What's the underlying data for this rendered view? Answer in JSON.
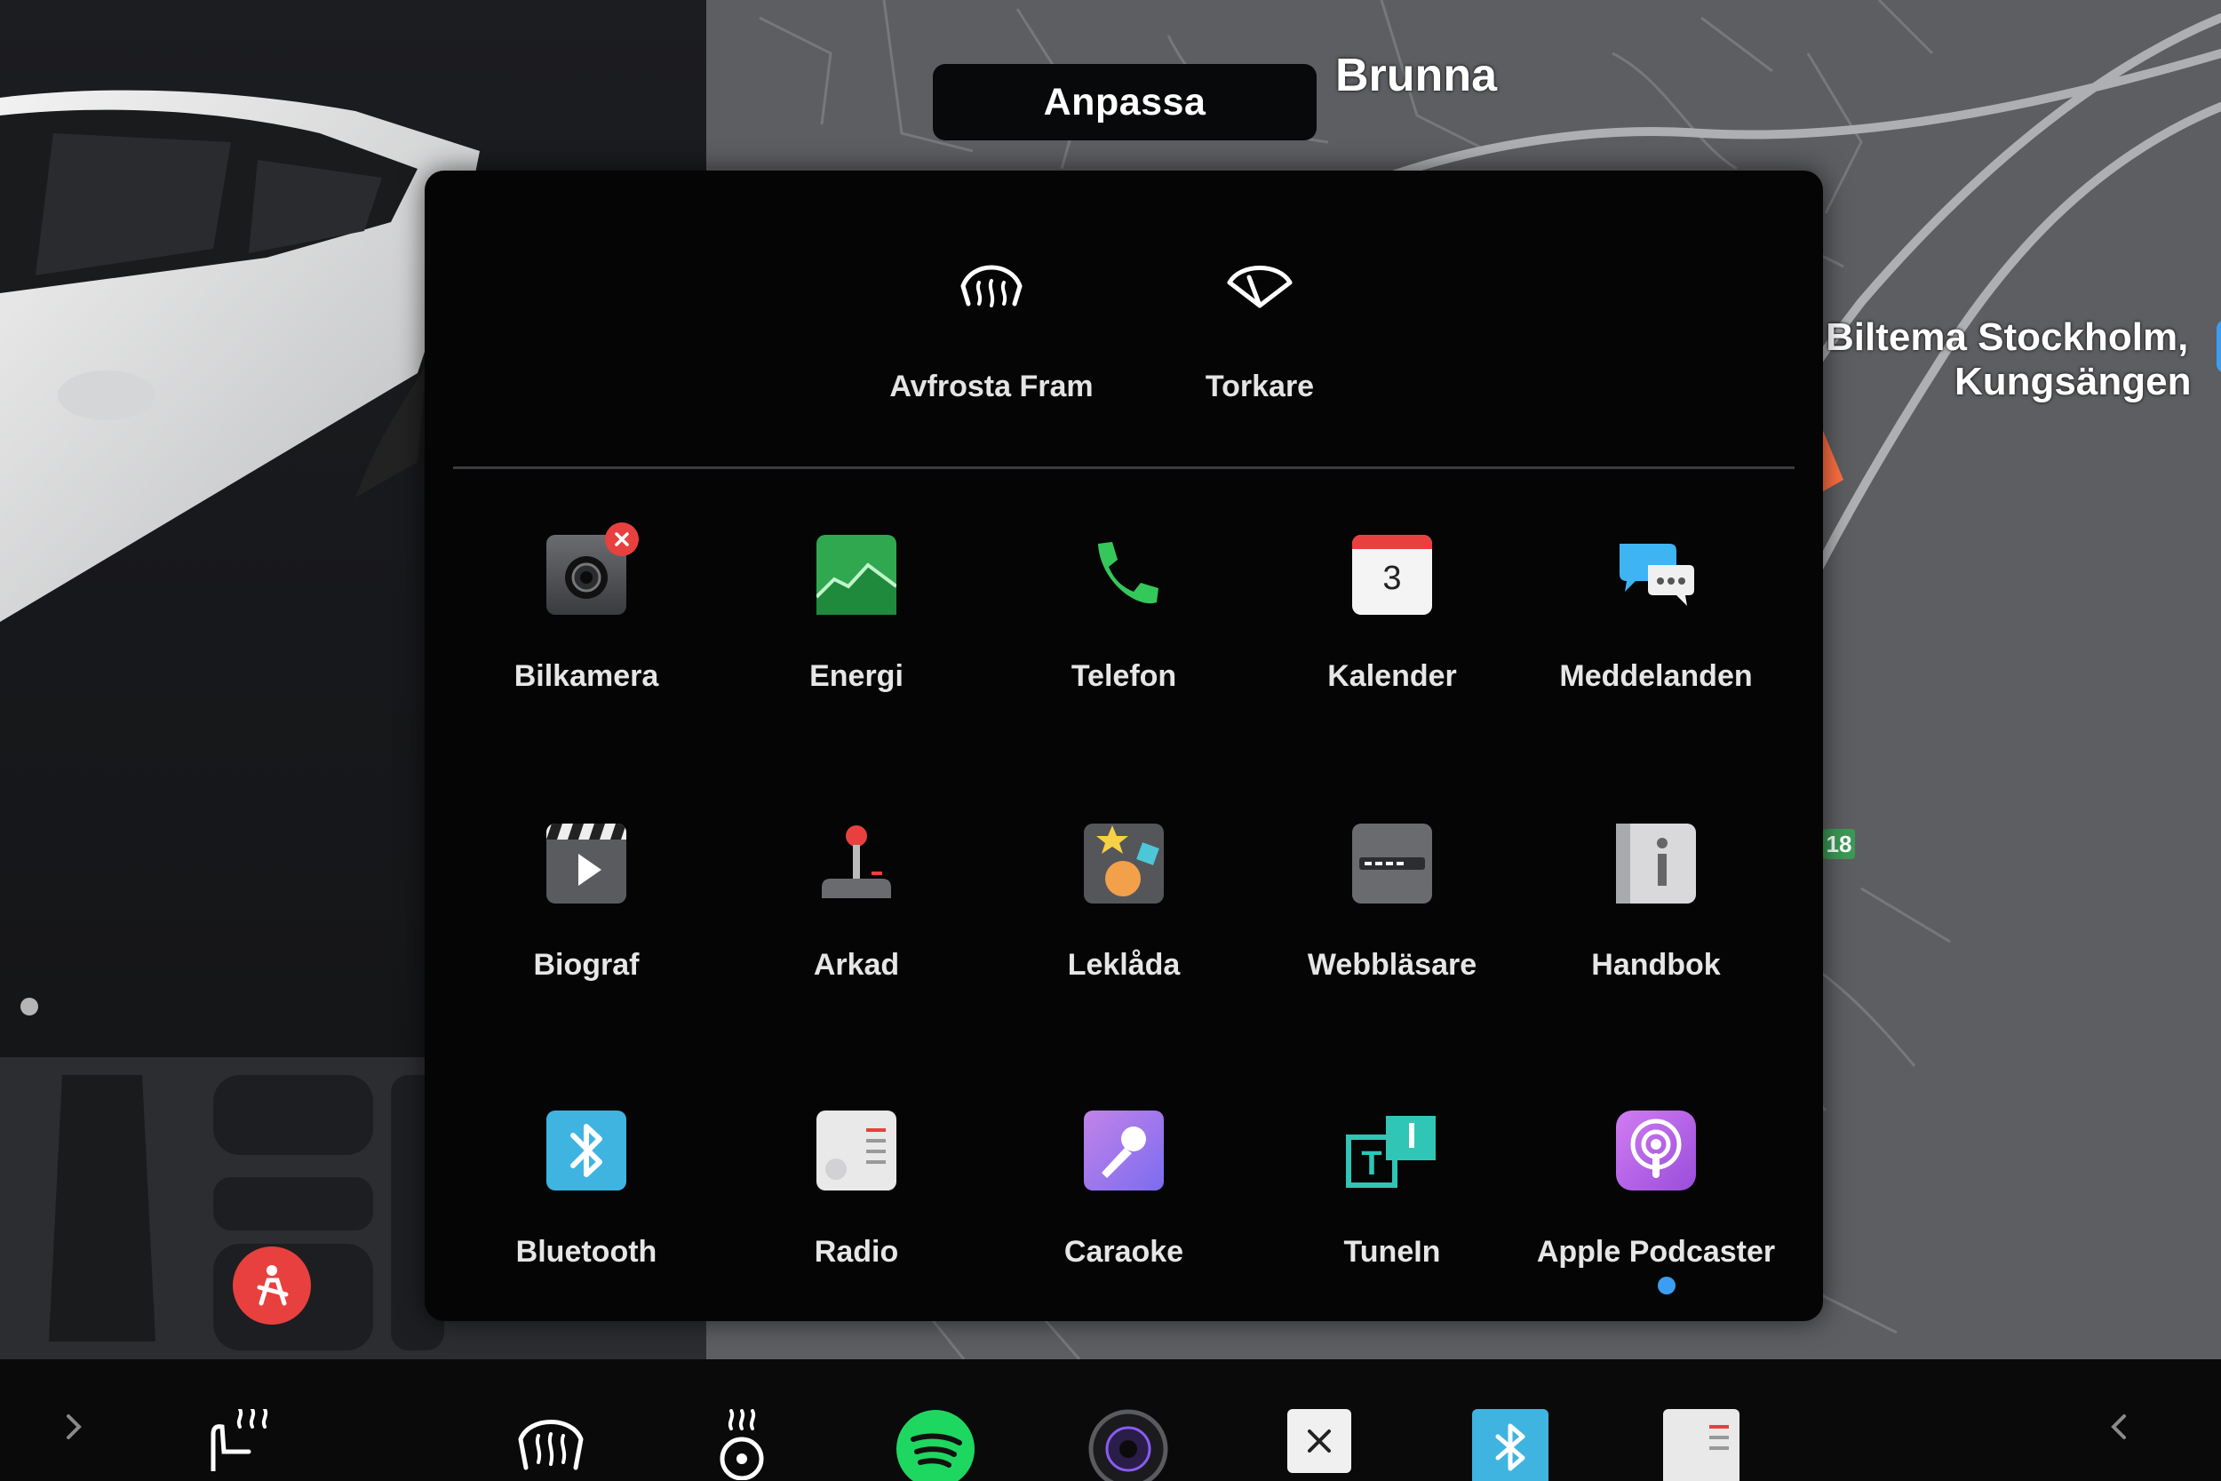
{
  "header": {
    "title": "Anpassa"
  },
  "map": {
    "place_label": "Brunna",
    "poi_line1": "Biltema Stockholm,",
    "poi_line2": "Kungsängen",
    "route_number": "18"
  },
  "quick_controls": [
    {
      "label": "Avfrosta Fram",
      "icon": "front-defrost-icon"
    },
    {
      "label": "Torkare",
      "icon": "wiper-icon"
    }
  ],
  "apps": [
    {
      "label": "Bilkamera",
      "icon": "camera-icon",
      "badge": "remove"
    },
    {
      "label": "Energi",
      "icon": "energy-chart-icon"
    },
    {
      "label": "Telefon",
      "icon": "phone-icon"
    },
    {
      "label": "Kalender",
      "icon": "calendar-icon",
      "icon_text": "3"
    },
    {
      "label": "Meddelanden",
      "icon": "messages-icon"
    },
    {
      "label": "Biograf",
      "icon": "clapperboard-icon"
    },
    {
      "label": "Arkad",
      "icon": "joystick-icon"
    },
    {
      "label": "Leklåda",
      "icon": "toybox-icon"
    },
    {
      "label": "Webbläsare",
      "icon": "browser-icon"
    },
    {
      "label": "Handbok",
      "icon": "manual-icon"
    },
    {
      "label": "Bluetooth",
      "icon": "bluetooth-icon"
    },
    {
      "label": "Radio",
      "icon": "radio-icon"
    },
    {
      "label": "Caraoke",
      "icon": "microphone-icon"
    },
    {
      "label": "TuneIn",
      "icon": "tunein-icon"
    },
    {
      "label": "Apple Podcaster",
      "icon": "podcast-icon"
    }
  ],
  "dock": [
    "chevron-right-icon",
    "seat-heater-icon",
    "front-defrost-icon",
    "steering-wheel-heat-icon",
    "spotify-icon",
    "camera-icon",
    "close-icon",
    "bluetooth-icon",
    "radio-icon",
    "chevron-left-icon"
  ],
  "colors": {
    "accent_blue": "#3b9ef2",
    "warning_red": "#e8403e",
    "energy_green": "#2fa84f",
    "phone_green": "#34c759"
  }
}
